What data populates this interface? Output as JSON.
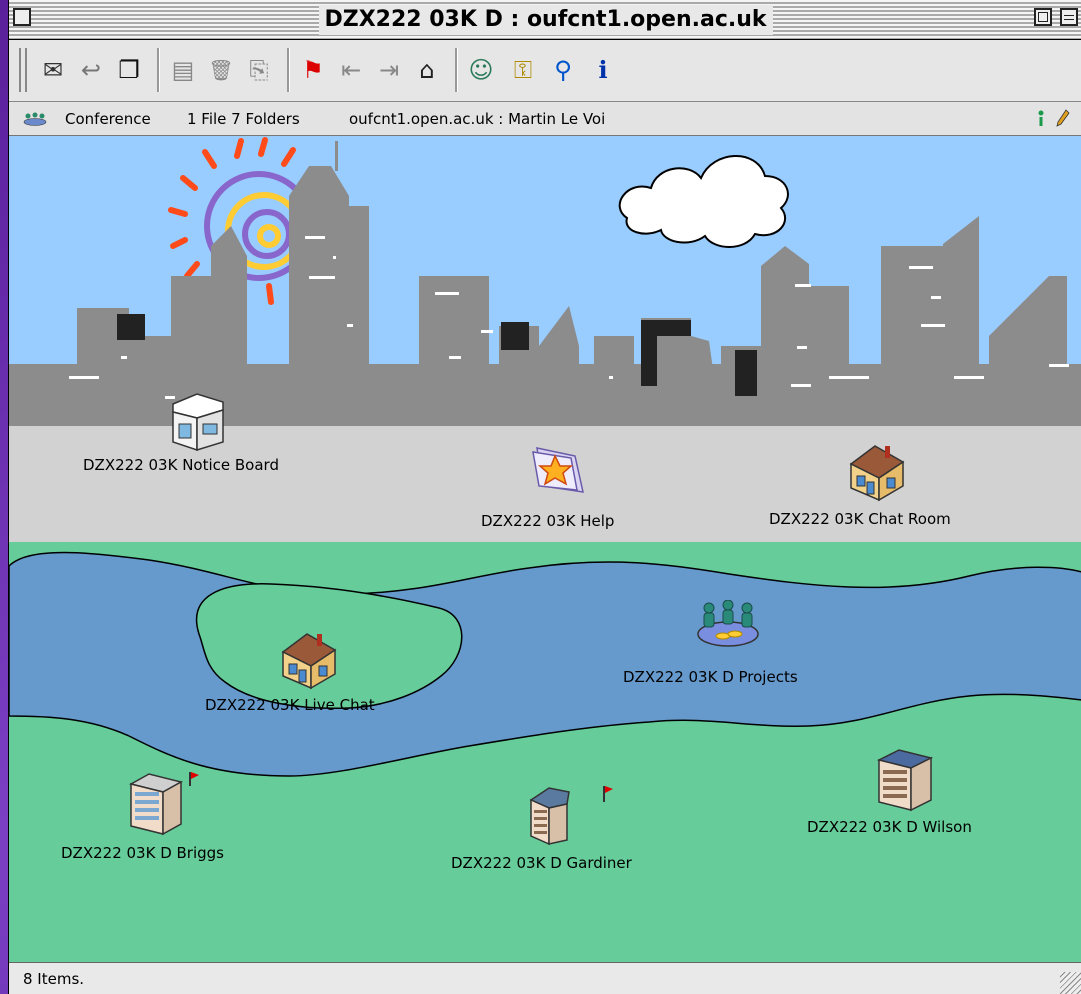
{
  "window": {
    "title": "DZX222 03K D : oufcnt1.open.ac.uk"
  },
  "toolbar": {
    "buttons": [
      {
        "name": "new-message-icon",
        "glyph": "✉"
      },
      {
        "name": "reply-icon",
        "glyph": "↩"
      },
      {
        "name": "new-document-icon",
        "glyph": "❐"
      },
      {
        "name": "print-icon",
        "glyph": "▤"
      },
      {
        "name": "trash-icon",
        "glyph": "🗑"
      },
      {
        "name": "forward-icon",
        "glyph": "⎘"
      },
      {
        "name": "next-unread-flag-icon",
        "glyph": "⚑"
      },
      {
        "name": "previous-icon",
        "glyph": "⇤"
      },
      {
        "name": "next-icon",
        "glyph": "⇥"
      },
      {
        "name": "open-folder-icon",
        "glyph": "⌂"
      },
      {
        "name": "add-user-icon",
        "glyph": "☺"
      },
      {
        "name": "user-key-icon",
        "glyph": "⚿"
      },
      {
        "name": "search-icon",
        "glyph": "⚲"
      },
      {
        "name": "info-icon",
        "glyph": "ℹ"
      }
    ]
  },
  "infobar": {
    "conference_label": "Conference",
    "counts": "1 File  7 Folders",
    "location": "oufcnt1.open.ac.uk  : Martin Le Voi"
  },
  "items": [
    {
      "label": "DZX222 03K Notice Board",
      "icon": "notice-board-building-icon"
    },
    {
      "label": "DZX222 03K Help",
      "icon": "help-document-icon"
    },
    {
      "label": "DZX222 03K Chat Room",
      "icon": "chat-room-house-icon"
    },
    {
      "label": "DZX222 03K Live Chat",
      "icon": "live-chat-house-icon"
    },
    {
      "label": "DZX222 03K D Projects",
      "icon": "projects-group-icon"
    },
    {
      "label": "DZX222 03K D Briggs",
      "icon": "briggs-building-icon"
    },
    {
      "label": "DZX222 03K D Gardiner",
      "icon": "gardiner-building-icon"
    },
    {
      "label": "DZX222 03K D Wilson",
      "icon": "wilson-building-icon"
    }
  ],
  "status": {
    "text": "8 Items."
  },
  "colors": {
    "sky": "#99ccff",
    "buildings": "#8c8c8c",
    "street": "#d2d2d2",
    "grass": "#66cc99",
    "river": "#6699cc",
    "sun_rays": "#ff4a1a",
    "sun_spiral": "#8866cc"
  }
}
